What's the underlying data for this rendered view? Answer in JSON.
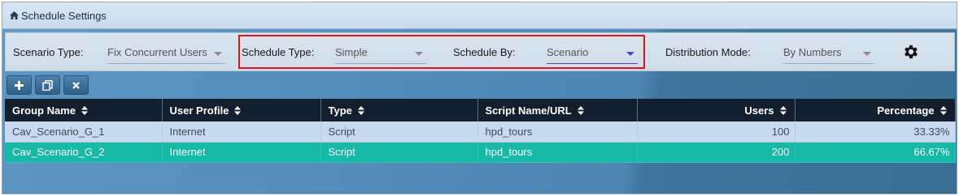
{
  "window": {
    "title": "Schedule Settings",
    "icon": "home-icon"
  },
  "filters": {
    "scenario_type": {
      "label": "Scenario Type:",
      "value": "Fix Concurrent Users"
    },
    "schedule_type": {
      "label": "Schedule Type:",
      "value": "Simple"
    },
    "schedule_by": {
      "label": "Schedule By:",
      "value": "Scenario"
    },
    "distribution_mode": {
      "label": "Distribution Mode:",
      "value": "By Numbers"
    },
    "settings_icon": "gear-icon",
    "highlight_color": "#e0131b"
  },
  "toolbar": {
    "buttons": [
      {
        "name": "add",
        "icon": "plus-icon"
      },
      {
        "name": "copy",
        "icon": "copy-icon"
      },
      {
        "name": "delete",
        "icon": "close-icon"
      }
    ]
  },
  "table": {
    "columns": [
      "Group Name",
      "User Profile",
      "Type",
      "Script Name/URL",
      "Users",
      "Percentage"
    ],
    "rows": [
      {
        "group_name": "Cav_Scenario_G_1",
        "user_profile": "Internet",
        "type": "Script",
        "script": "hpd_tours",
        "users": "100",
        "percentage": "33.33%",
        "selected": false
      },
      {
        "group_name": "Cav_Scenario_G_2",
        "user_profile": "Internet",
        "type": "Script",
        "script": "hpd_tours",
        "users": "200",
        "percentage": "66.67%",
        "selected": true
      }
    ]
  },
  "colors": {
    "header_bg": "#12202e",
    "row_bg": "#c7daf2",
    "selected_row_bg": "#17b8a6",
    "panel_bg": "#4f88b6"
  }
}
